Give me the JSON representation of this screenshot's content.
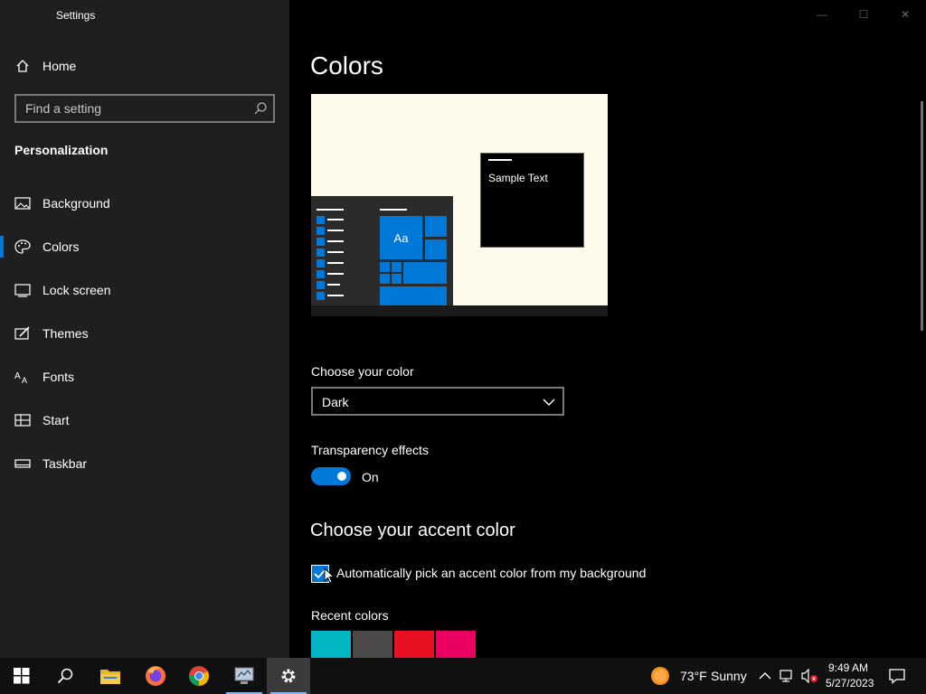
{
  "window": {
    "title": "Settings",
    "controls": {
      "minimize": "—",
      "maximize": "☐",
      "close": "✕"
    }
  },
  "sidebar": {
    "home_label": "Home",
    "search_placeholder": "Find a setting",
    "section_title": "Personalization",
    "items": [
      {
        "label": "Background",
        "icon": "picture-icon",
        "selected": false
      },
      {
        "label": "Colors",
        "icon": "palette-icon",
        "selected": true
      },
      {
        "label": "Lock screen",
        "icon": "lock-screen-icon",
        "selected": false
      },
      {
        "label": "Themes",
        "icon": "themes-icon",
        "selected": false
      },
      {
        "label": "Fonts",
        "icon": "fonts-icon",
        "selected": false
      },
      {
        "label": "Start",
        "icon": "start-icon",
        "selected": false
      },
      {
        "label": "Taskbar",
        "icon": "taskbar-icon",
        "selected": false
      }
    ]
  },
  "main": {
    "title": "Colors",
    "preview": {
      "sample_text": "Sample Text",
      "tile_label": "Aa"
    },
    "choose_color": {
      "label": "Choose your color",
      "value": "Dark"
    },
    "transparency": {
      "label": "Transparency effects",
      "state": "On",
      "enabled": true
    },
    "accent": {
      "title": "Choose your accent color",
      "auto_label": "Automatically pick an accent color from my background",
      "auto_checked": true
    },
    "recent_colors": {
      "label": "Recent colors",
      "swatches": [
        "#00b7c3",
        "#4c4a48",
        "#e81123",
        "#ea005e"
      ]
    }
  },
  "taskbar": {
    "apps": [
      "start-icon",
      "search-icon",
      "file-explorer-icon",
      "firefox-icon",
      "chrome-icon",
      "control-panel-icon",
      "settings-gear-icon"
    ],
    "weather": {
      "temp": "73°F",
      "condition": "Sunny"
    },
    "clock": {
      "time": "9:49 AM",
      "date": "5/27/2023"
    }
  },
  "colors": {
    "accent": "#0078d7",
    "sidebar_bg": "#1f1f1f",
    "main_bg": "#000000",
    "preview_bg": "#fefbec"
  }
}
